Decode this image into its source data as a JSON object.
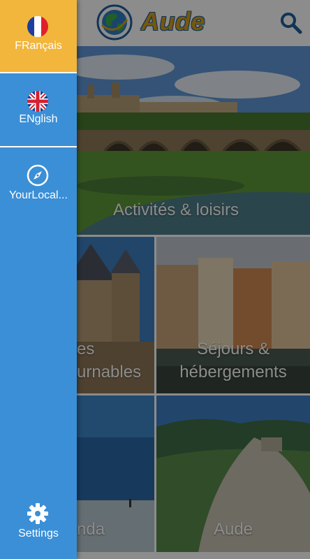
{
  "app": {
    "title": "Aude",
    "search_icon": "search-icon",
    "logo_icon": "globe-logo-icon"
  },
  "tiles": [
    {
      "label": "Activités & loisirs"
    },
    {
      "label_line1": "es",
      "label_line2": "urnables"
    },
    {
      "label_line1": "Séjours &",
      "label_line2": "hébergements"
    },
    {
      "label": "nda"
    },
    {
      "label": "Aude"
    }
  ],
  "drawer": {
    "items": [
      {
        "label": "FRançais",
        "icon": "france-flag-icon",
        "active": true
      },
      {
        "label": "ENglish",
        "icon": "uk-flag-icon",
        "active": false
      },
      {
        "label": "YourLocal...",
        "icon": "compass-icon",
        "active": false
      }
    ],
    "settings": {
      "label": "Settings",
      "icon": "gear-icon"
    }
  },
  "colors": {
    "drawer_bg": "#3b8fd6",
    "drawer_active_bg": "#f2b63c",
    "logo_text": "#d8a019",
    "logo_outline": "#1f5f9c"
  }
}
